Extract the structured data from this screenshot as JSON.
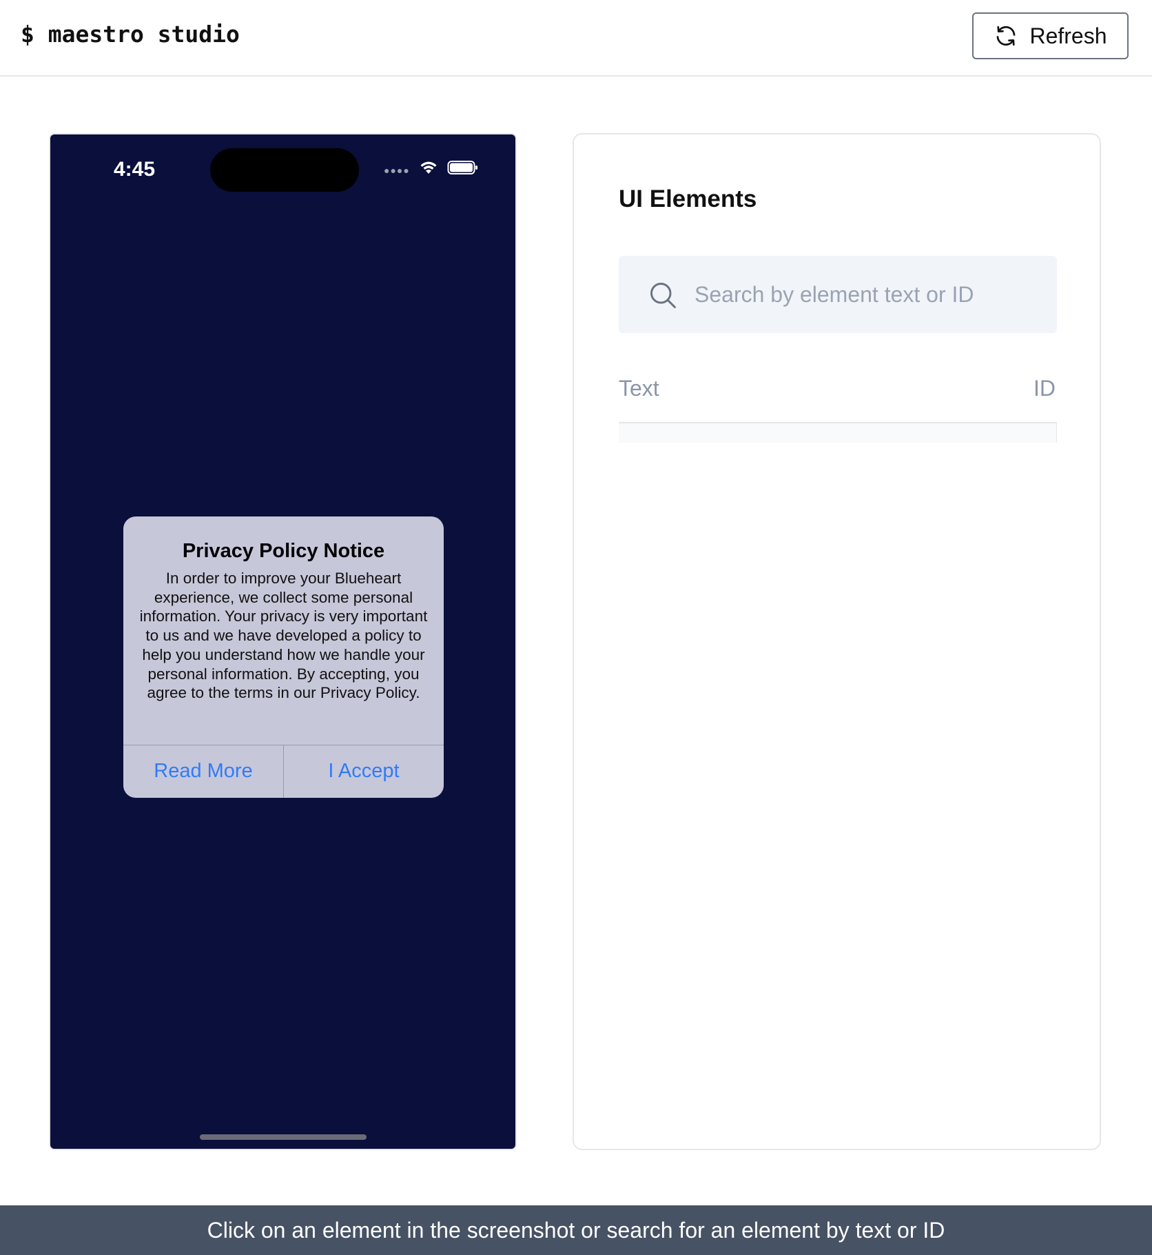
{
  "header": {
    "app_title": "$ maestro studio",
    "refresh_label": "Refresh"
  },
  "device": {
    "status_time": "4:45",
    "alert": {
      "title": "Privacy Policy Notice",
      "message": "In order to improve your Blueheart experience, we collect some personal information. Your privacy is very important to us and we have developed a policy to help you understand how we handle your personal information. By accepting, you agree to the terms in our Privacy Policy.",
      "buttons": [
        "Read More",
        "I Accept"
      ]
    },
    "colors": {
      "background": "#0a0f3c",
      "alert_bg": "#c7c7da",
      "alert_button": "#2f7cf6"
    }
  },
  "panel": {
    "title": "UI Elements",
    "search_placeholder": "Search by element text or ID",
    "columns": {
      "text": "Text",
      "id": "ID"
    },
    "rows": []
  },
  "footer": {
    "hint": "Click on an element in the screenshot or search for an element by text or ID"
  }
}
